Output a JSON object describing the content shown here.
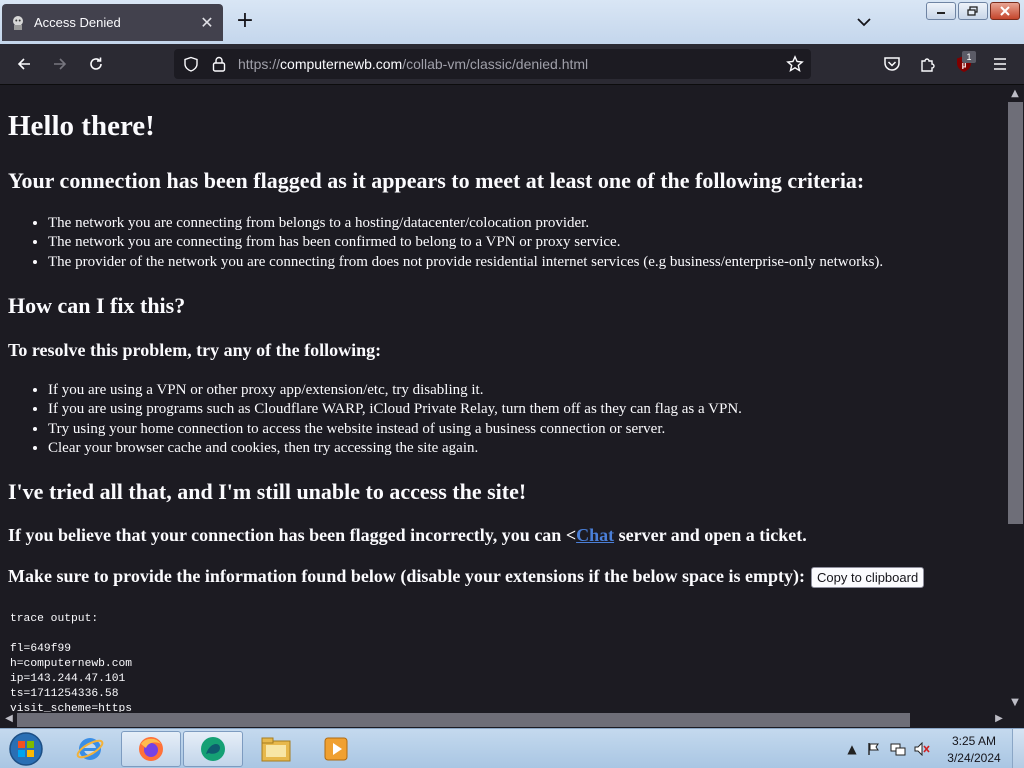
{
  "browser": {
    "tab_title": "Access Denied",
    "url_domain": "computernewb.com",
    "url_prefix": "https://",
    "url_path": "/collab-vm/classic/denied.html",
    "extension_badge": "1"
  },
  "page": {
    "heading": "Hello there!",
    "flag_heading": "Your connection has been flagged as it appears to meet at least one of the following criteria:",
    "criteria": [
      "The network you are connecting from belongs to a hosting/datacenter/colocation provider.",
      "The network you are connecting from has been confirmed to belong to a VPN or proxy service.",
      "The provider of the network you are connecting from does not provide residential internet services (e.g business/enterprise-only networks)."
    ],
    "fix_heading": "How can I fix this?",
    "resolve_heading": "To resolve this problem, try any of the following:",
    "fixes": [
      "If you are using a VPN or other proxy app/extension/etc, try disabling it.",
      "If you are using programs such as Cloudflare WARP, iCloud Private Relay, turn them off as they can flag as a VPN.",
      "Try using your home connection to access the website instead of using a business connection or server.",
      "Clear your browser cache and cookies, then try accessing the site again."
    ],
    "tried_heading": "I've tried all that, and I'm still unable to access the site!",
    "incorrect_prefix": "If you believe that your connection has been flagged incorrectly, you can <",
    "chat_link": "Chat",
    "incorrect_suffix": " server and open a ticket.",
    "info_heading": "Make sure to provide the information found below (disable your extensions if the below space is empty):",
    "copy_button": "Copy to clipboard",
    "trace": "trace output:\n\nfl=649f99\nh=computernewb.com\nip=143.244.47.101\nts=1711254336.58\nvisit_scheme=https"
  },
  "taskbar": {
    "time": "3:25 AM",
    "date": "3/24/2024"
  }
}
